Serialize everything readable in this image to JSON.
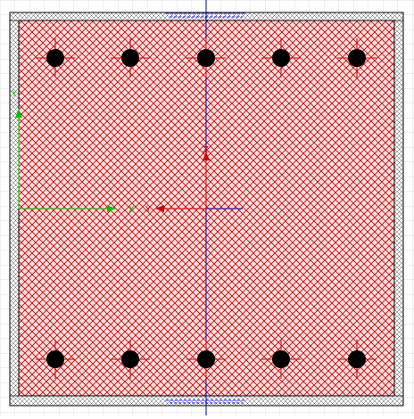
{
  "drawing": {
    "colors": {
      "background": "#ffffff",
      "grid": "#d9d9d9",
      "outline": "#000000",
      "hatch": "#c00000",
      "hatch_bg": "#ffd9d9",
      "rebar": "#000000",
      "crosshair_red": "#d00000",
      "axis_blue": "#0000a0",
      "axis_green": "#00c000",
      "cover_blue": "#1a1aff"
    },
    "labels": {
      "global_y": "Y",
      "global_x": "X",
      "local_z": "Z",
      "local_y": "Y"
    },
    "section": {
      "rebar_top_count": 5,
      "rebar_bottom_count": 5,
      "hatch": "crosshatch"
    },
    "icons": {
      "rebar": "rebar-circle-icon",
      "axis": "axis-arrow-icon"
    }
  }
}
